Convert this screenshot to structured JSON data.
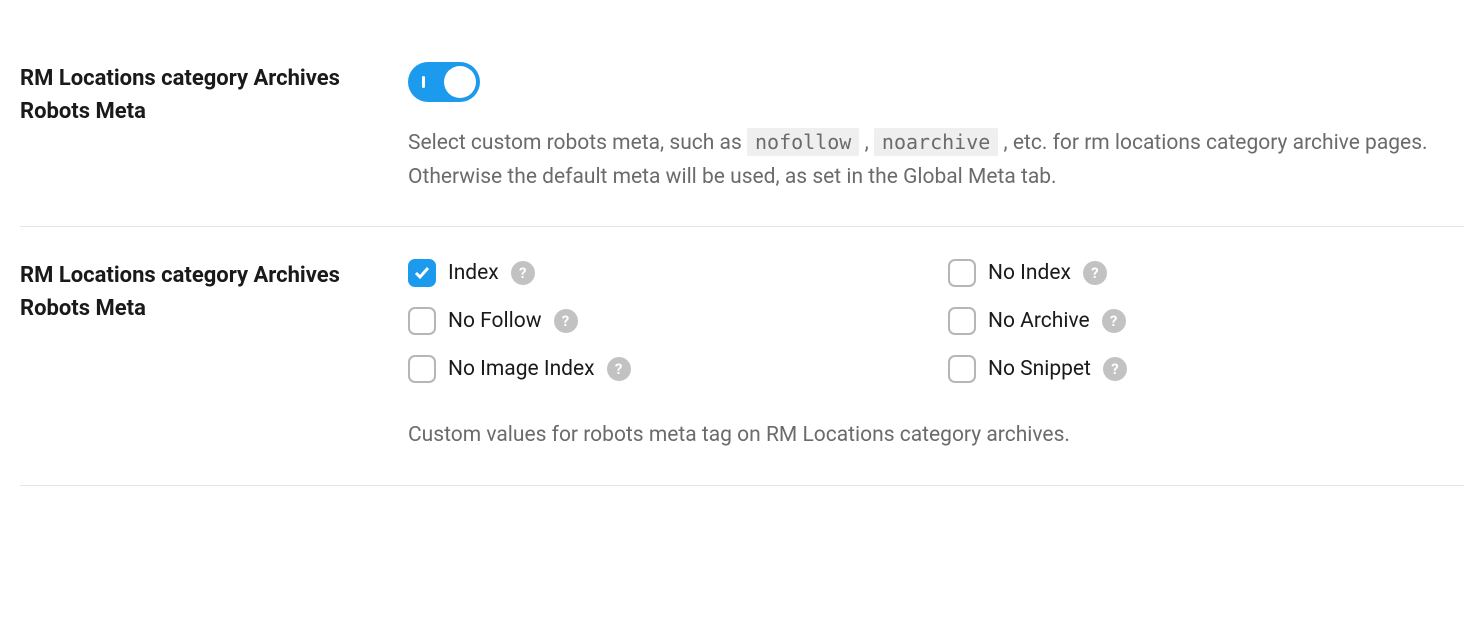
{
  "section1": {
    "label": "RM Locations category Archives Robots Meta",
    "toggle_on": true,
    "desc_pre": "Select custom robots meta, such as ",
    "code1": "nofollow",
    "desc_mid": ", ",
    "code2": "noarchive",
    "desc_post": ", etc. for rm locations category archive pages. Otherwise the default meta will be used, as set in the Global Meta tab."
  },
  "section2": {
    "label": "RM Locations category Archives Robots Meta",
    "options": [
      {
        "label": "Index",
        "checked": true
      },
      {
        "label": "No Index",
        "checked": false
      },
      {
        "label": "No Follow",
        "checked": false
      },
      {
        "label": "No Archive",
        "checked": false
      },
      {
        "label": "No Image Index",
        "checked": false
      },
      {
        "label": "No Snippet",
        "checked": false
      }
    ],
    "desc": "Custom values for robots meta tag on RM Locations category archives."
  }
}
